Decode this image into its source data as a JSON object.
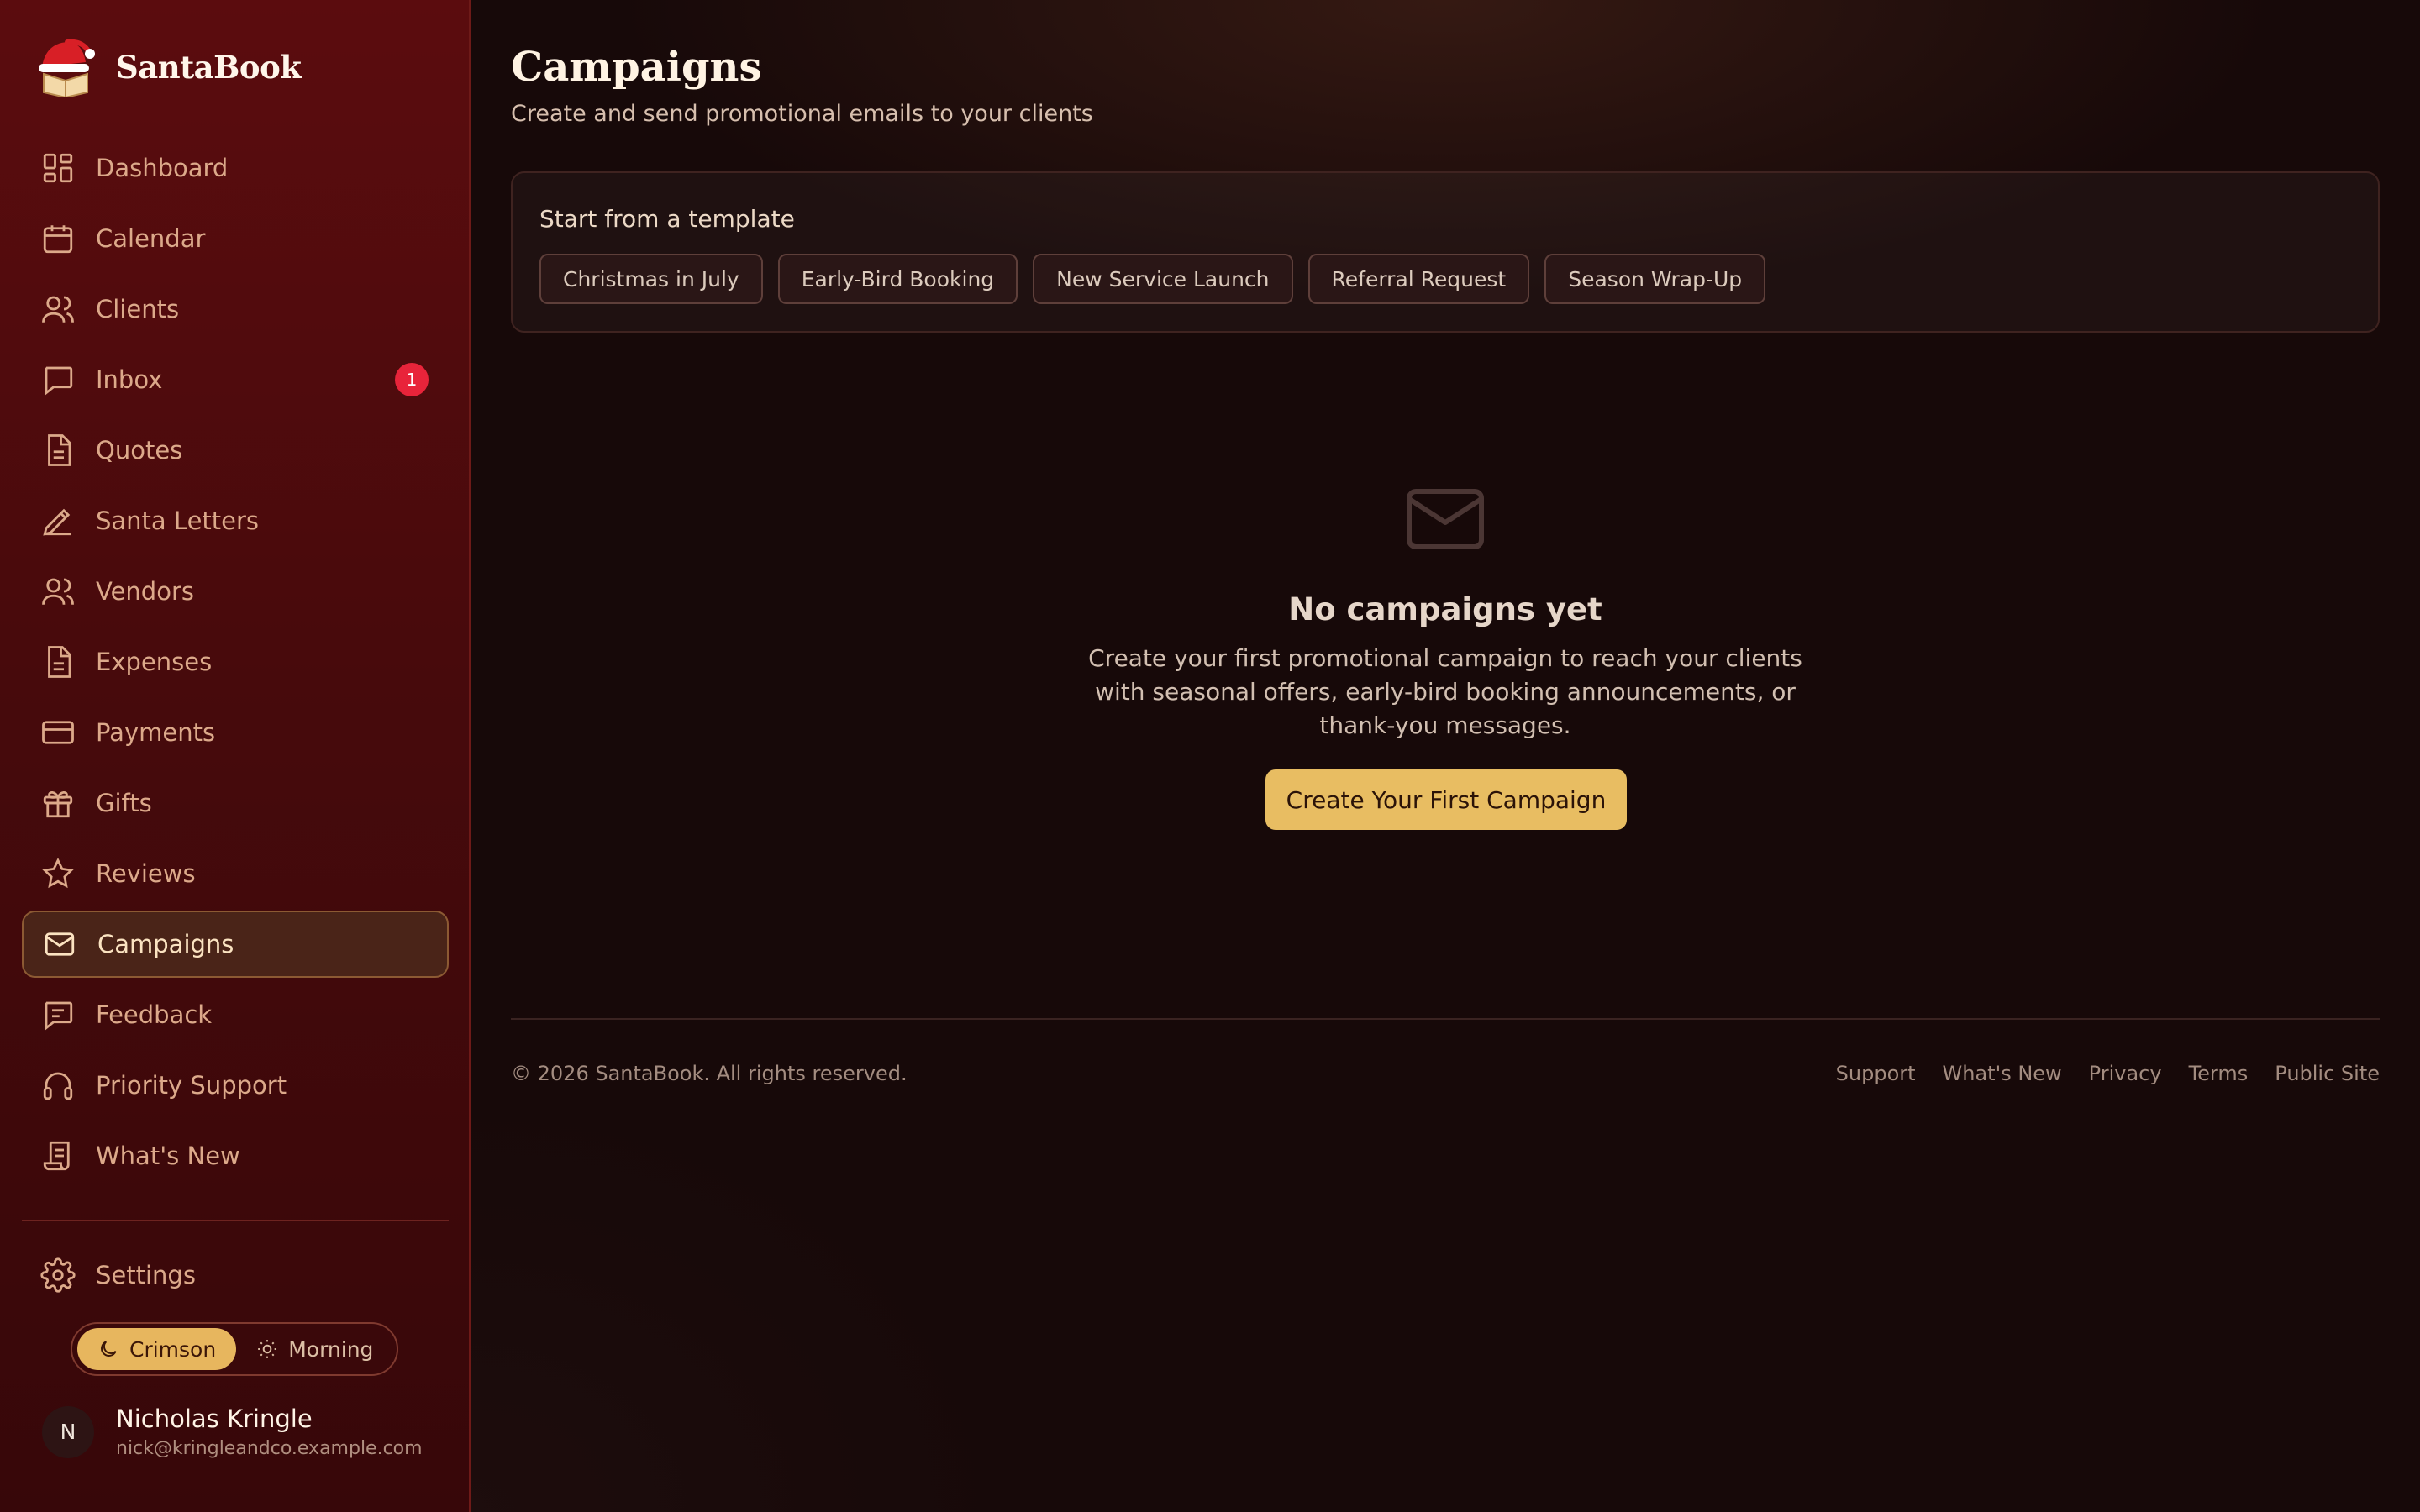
{
  "brand": {
    "name": "SantaBook",
    "logo_icon": "santa-hat-book-icon"
  },
  "sidebar": {
    "items": [
      {
        "label": "Dashboard",
        "icon": "dashboard-icon"
      },
      {
        "label": "Calendar",
        "icon": "calendar-icon"
      },
      {
        "label": "Clients",
        "icon": "users-icon"
      },
      {
        "label": "Inbox",
        "icon": "message-icon",
        "badge": "1"
      },
      {
        "label": "Quotes",
        "icon": "document-icon"
      },
      {
        "label": "Santa Letters",
        "icon": "pen-icon"
      },
      {
        "label": "Vendors",
        "icon": "users-icon"
      },
      {
        "label": "Expenses",
        "icon": "document-icon"
      },
      {
        "label": "Payments",
        "icon": "credit-card-icon"
      },
      {
        "label": "Gifts",
        "icon": "gift-icon"
      },
      {
        "label": "Reviews",
        "icon": "star-icon"
      },
      {
        "label": "Campaigns",
        "icon": "mail-icon",
        "active": true
      },
      {
        "label": "Feedback",
        "icon": "message-lines-icon"
      },
      {
        "label": "Priority Support",
        "icon": "headphones-icon"
      },
      {
        "label": "What's New",
        "icon": "scroll-icon"
      }
    ],
    "settings_label": "Settings",
    "theme": {
      "dark_label": "Crimson",
      "light_label": "Morning",
      "selected": "Crimson"
    },
    "user": {
      "initial": "N",
      "name": "Nicholas Kringle",
      "email": "nick@kringleandco.example.com"
    }
  },
  "header": {
    "title": "Campaigns",
    "subtitle": "Create and send promotional emails to your clients"
  },
  "templates": {
    "heading": "Start from a template",
    "chips": [
      "Christmas in July",
      "Early-Bird Booking",
      "New Service Launch",
      "Referral Request",
      "Season Wrap-Up"
    ]
  },
  "empty_state": {
    "icon": "mail-icon",
    "title": "No campaigns yet",
    "description": "Create your first promotional campaign to reach your clients with seasonal offers, early-bird booking announcements, or thank-you messages.",
    "cta_label": "Create Your First Campaign"
  },
  "footer": {
    "copyright": "© 2026 SantaBook. All rights reserved.",
    "links": [
      "Support",
      "What's New",
      "Privacy",
      "Terms",
      "Public Site"
    ]
  },
  "colors": {
    "sidebar_bg": "#5b0c0e",
    "main_bg": "#170909",
    "accent_gold": "#e8bd62",
    "badge_red": "#e8243a"
  }
}
